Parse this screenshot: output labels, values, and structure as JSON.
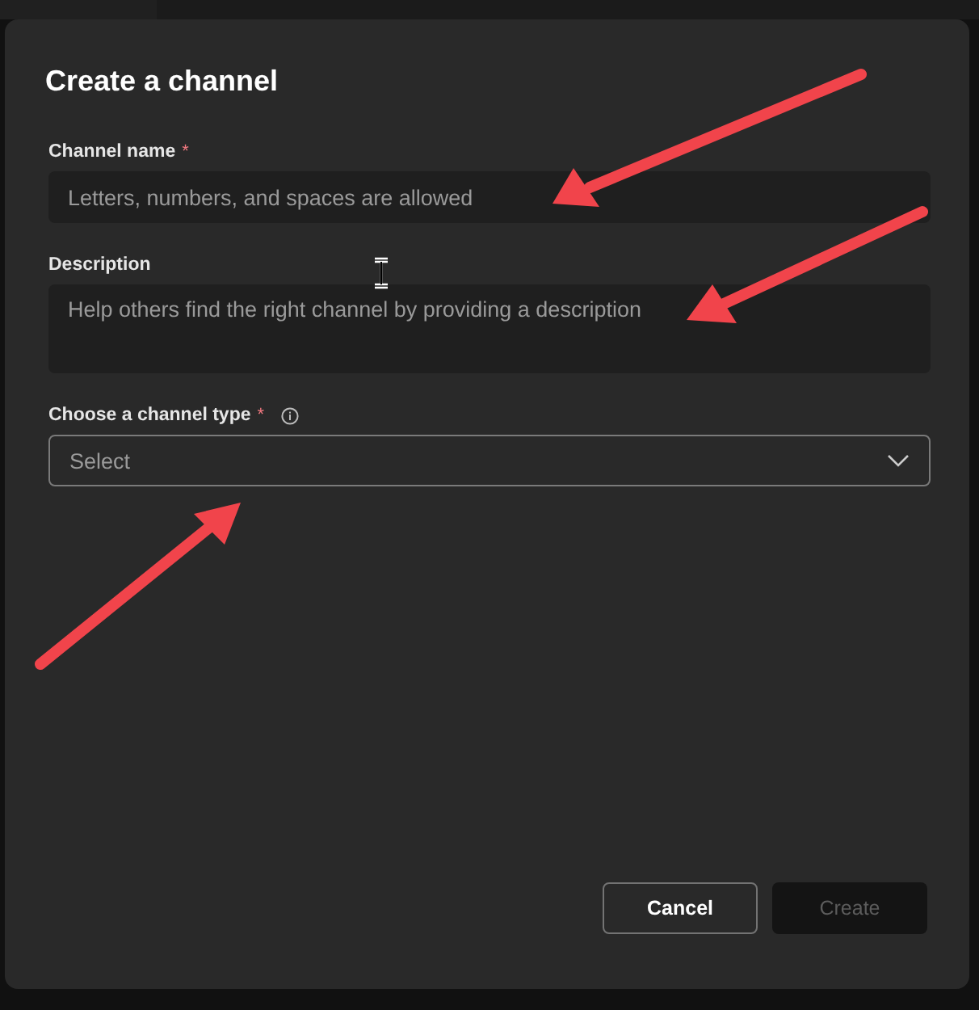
{
  "dialog": {
    "title": "Create a channel",
    "fields": [
      {
        "kind": "text",
        "label": "Channel name",
        "required_mark": "*",
        "info": false,
        "placeholder": "Letters, numbers, and spaces are allowed"
      },
      {
        "kind": "textarea",
        "label": "Description",
        "info": false,
        "placeholder": "Help others find the right channel by providing a description"
      },
      {
        "kind": "select",
        "label": "Choose a channel type",
        "required_mark": "*",
        "info": true,
        "placeholder": "Select"
      }
    ],
    "buttons": [
      {
        "label": "Cancel",
        "disabled": false
      },
      {
        "label": "Create",
        "disabled": true
      }
    ]
  }
}
